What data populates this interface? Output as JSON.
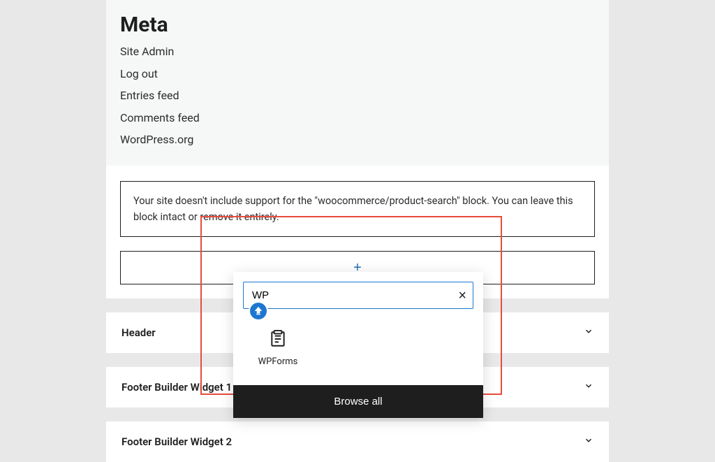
{
  "meta": {
    "title": "Meta",
    "links": [
      "Site Admin",
      "Log out",
      "Entries feed",
      "Comments feed",
      "WordPress.org"
    ]
  },
  "warning": "Your site doesn't include support for the \"woocommerce/product-search\" block. You can leave this block intact or remove it entirely.",
  "accordions": [
    "Header",
    "Footer Builder Widget 1",
    "Footer Builder Widget 2"
  ],
  "popover": {
    "search_value": "WP",
    "result_label": "WPForms",
    "browse_all": "Browse all"
  }
}
